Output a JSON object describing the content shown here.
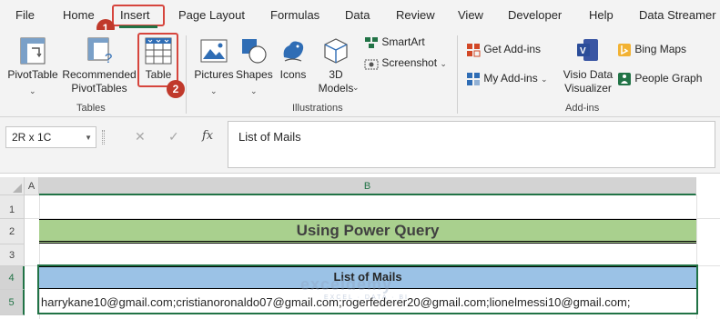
{
  "menu": {
    "items": [
      "File",
      "Home",
      "Insert",
      "Page Layout",
      "Formulas",
      "Data",
      "Review",
      "View",
      "Developer",
      "Help",
      "Data Streamer"
    ],
    "active": "Insert"
  },
  "steps": {
    "step1": "1",
    "step2": "2"
  },
  "ribbon": {
    "tables": {
      "pivot_table": "PivotTable",
      "recommended_line1": "Recommended",
      "recommended_line2": "PivotTables",
      "table": "Table",
      "group_label": "Tables"
    },
    "illustrations": {
      "pictures": "Pictures",
      "shapes": "Shapes",
      "icons": "Icons",
      "models_line1": "3D",
      "models_line2": "Models",
      "smartart": "SmartArt",
      "screenshot": "Screenshot",
      "group_label": "Illustrations"
    },
    "addins": {
      "get_addins": "Get Add-ins",
      "my_addins": "My Add-ins",
      "visio_line1": "Visio Data",
      "visio_line2": "Visualizer",
      "bing_maps": "Bing Maps",
      "people_graph": "People Graph",
      "group_label": "Add-ins"
    }
  },
  "formula_bar": {
    "name_box": "2R x 1C",
    "formula": "List of Mails"
  },
  "grid": {
    "columns": [
      "A",
      "B"
    ],
    "rows": [
      "1",
      "2",
      "3",
      "4",
      "5"
    ],
    "title": "Using Power Query",
    "header": "List of Mails",
    "data": "harrykane10@gmail.com;cristianoronaldo07@gmail.com;rogerfederer20@gmail.com;lionelmessi10@gmail.com;"
  },
  "watermark": {
    "line1": "exceldemy",
    "line2": "EXCEL · DATA · BI"
  },
  "colors": {
    "excel_green": "#217346",
    "title_fill": "#a9d08e",
    "header_fill": "#9bc2e6",
    "highlight": "#d6453d"
  }
}
